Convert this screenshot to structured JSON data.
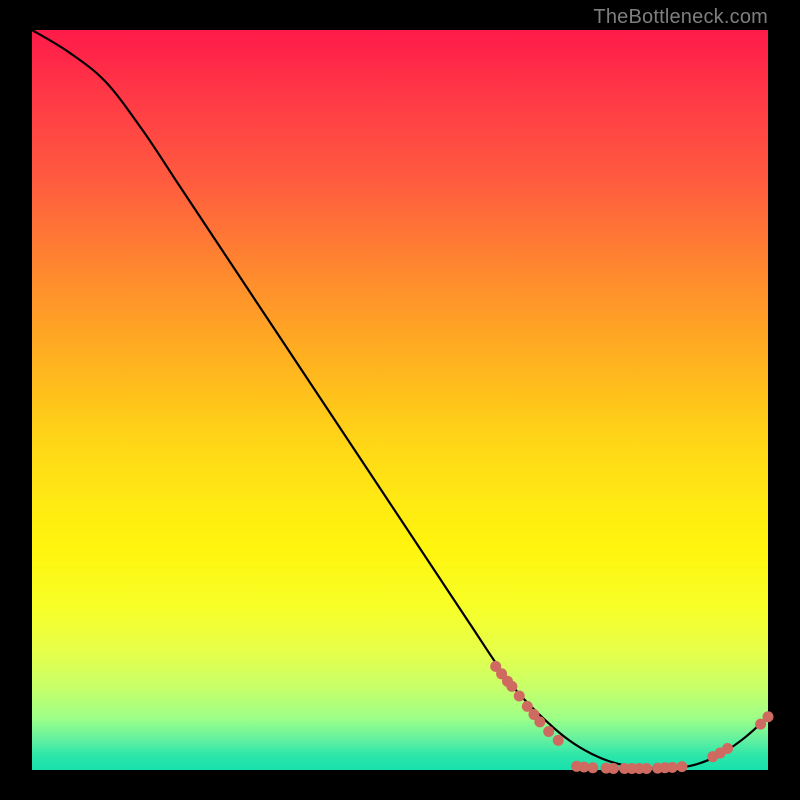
{
  "watermark": "TheBottleneck.com",
  "colors": {
    "background": "#000000",
    "curve_stroke": "#000000",
    "marker_fill": "#cf6a60",
    "watermark_text": "#7e7e7e"
  },
  "chart_data": {
    "type": "line",
    "title": "",
    "xlabel": "",
    "ylabel": "",
    "xlim": [
      0,
      100
    ],
    "ylim": [
      0,
      100
    ],
    "grid": false,
    "series": [
      {
        "name": "bottleneck-curve",
        "x": [
          0,
          5,
          10,
          15,
          20,
          25,
          30,
          35,
          40,
          45,
          50,
          55,
          60,
          63,
          66,
          70,
          73,
          76,
          79,
          82,
          85,
          88,
          91,
          94,
          97,
          100
        ],
        "y": [
          100,
          97,
          93,
          86.5,
          79,
          71.5,
          64,
          56.5,
          49,
          41.5,
          34,
          26.5,
          19,
          14.5,
          10.5,
          6.5,
          4,
          2.2,
          1.0,
          0.4,
          0.2,
          0.3,
          1.0,
          2.4,
          4.5,
          7.2
        ]
      }
    ],
    "markers": [
      {
        "x": 63.0,
        "y": 14.0
      },
      {
        "x": 63.8,
        "y": 13.0
      },
      {
        "x": 64.6,
        "y": 12.0
      },
      {
        "x": 65.2,
        "y": 11.3
      },
      {
        "x": 66.2,
        "y": 10.0
      },
      {
        "x": 67.3,
        "y": 8.6
      },
      {
        "x": 68.2,
        "y": 7.5
      },
      {
        "x": 69.0,
        "y": 6.5
      },
      {
        "x": 70.2,
        "y": 5.2
      },
      {
        "x": 71.5,
        "y": 4.0
      },
      {
        "x": 74.0,
        "y": 0.5
      },
      {
        "x": 75.0,
        "y": 0.4
      },
      {
        "x": 76.2,
        "y": 0.3
      },
      {
        "x": 78.0,
        "y": 0.25
      },
      {
        "x": 79.0,
        "y": 0.2
      },
      {
        "x": 80.5,
        "y": 0.2
      },
      {
        "x": 81.5,
        "y": 0.2
      },
      {
        "x": 82.5,
        "y": 0.2
      },
      {
        "x": 83.5,
        "y": 0.2
      },
      {
        "x": 85.0,
        "y": 0.25
      },
      {
        "x": 86.0,
        "y": 0.3
      },
      {
        "x": 87.0,
        "y": 0.35
      },
      {
        "x": 88.3,
        "y": 0.45
      },
      {
        "x": 92.5,
        "y": 1.8
      },
      {
        "x": 93.5,
        "y": 2.3
      },
      {
        "x": 94.5,
        "y": 2.9
      },
      {
        "x": 99.0,
        "y": 6.2
      },
      {
        "x": 100.0,
        "y": 7.2
      }
    ]
  }
}
